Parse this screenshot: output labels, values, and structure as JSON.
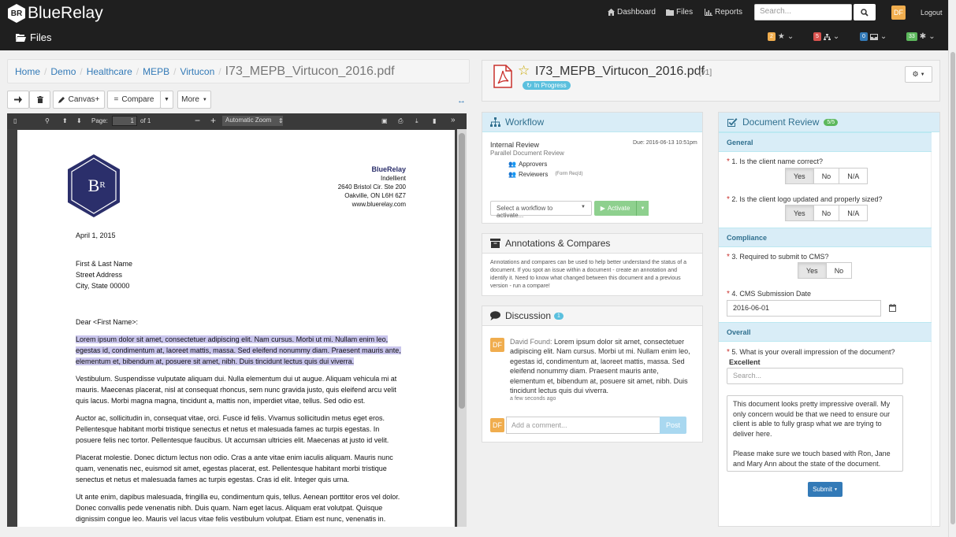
{
  "app": {
    "name": "BlueRelay",
    "logo_mark": "BR",
    "page_title": "Files"
  },
  "nav": {
    "dashboard": "Dashboard",
    "files": "Files",
    "reports": "Reports",
    "search_placeholder": "Search...",
    "avatar": "DF",
    "logout": "Logout"
  },
  "badges": [
    {
      "count": "2",
      "color": "#f0ad4e",
      "icon": "star-icon"
    },
    {
      "count": "5",
      "color": "#d9534f",
      "icon": "sitemap-icon"
    },
    {
      "count": "0",
      "color": "#337ab7",
      "icon": "inbox-icon"
    },
    {
      "count": "33",
      "color": "#5cb85c",
      "icon": "asterisk-icon"
    }
  ],
  "breadcrumb": {
    "items": [
      "Home",
      "Demo",
      "Healthcare",
      "MEPB",
      "Virtucon"
    ],
    "current": "I73_MEPB_Virtucon_2016.pdf"
  },
  "toolbar": {
    "canvas": "Canvas+",
    "compare": "Compare",
    "more": "More"
  },
  "viewer": {
    "page_label": "Page:",
    "page": "1",
    "of": "of 1",
    "zoom": "Automatic Zoom"
  },
  "pdf": {
    "company": "BlueRelay",
    "addr1": "Indellient",
    "addr2": "2640 Bristol Cir. Ste 200",
    "addr3": "Oakville, ON L6H 6Z7",
    "addr4": "www.bluerelay.com",
    "date": "April 1, 2015",
    "to1": "First & Last Name",
    "to2": "Street Address",
    "to3": "City, State 00000",
    "greeting": "Dear <First Name>:",
    "p1": "Lorem ipsum dolor sit amet, consectetuer adipiscing elit. Nam cursus. Morbi ut mi. Nullam enim leo, egestas id, condimentum at, laoreet mattis, massa. Sed eleifend nonummy diam. Praesent mauris ante, elementum et, bibendum at, posuere sit amet, nibh. Duis tincidunt lectus quis dui viverra.",
    "p2": "Vestibulum. Suspendisse vulputate aliquam dui. Nulla elementum dui ut augue. Aliquam vehicula mi at mauris. Maecenas placerat, nisl at consequat rhoncus, sem nunc gravida justo, quis eleifend arcu velit quis lacus. Morbi magna magna, tincidunt a, mattis non, imperdiet vitae, tellus. Sed odio est.",
    "p3": "Auctor ac, sollicitudin in, consequat vitae, orci. Fusce id felis. Vivamus sollicitudin metus eget eros. Pellentesque habitant morbi tristique senectus et netus et malesuada fames ac turpis egestas. In posuere felis nec tortor. Pellentesque faucibus. Ut accumsan ultricies elit. Maecenas at justo id velit.",
    "p4": "Placerat molestie. Donec dictum lectus non odio. Cras a ante vitae enim iaculis aliquam. Mauris nunc quam, venenatis nec, euismod sit amet, egestas placerat, est. Pellentesque habitant morbi tristique senectus et netus et malesuada fames ac turpis egestas. Cras id elit. Integer quis urna.",
    "p5": "Ut ante enim, dapibus malesuada, fringilla eu, condimentum quis, tellus. Aenean porttitor eros vel dolor. Donec convallis pede venenatis nibh. Duis quam. Nam eget lacus. Aliquam erat volutpat. Quisque dignissim congue leo. Mauris vel lacus vitae felis vestibulum volutpat. Etiam est nunc, venenatis in."
  },
  "document": {
    "title": "I73_MEPB_Virtucon_2016.pdf",
    "version": "[v1]",
    "status": "In Progress"
  },
  "workflow": {
    "title": "Workflow",
    "name": "Internal Review",
    "due": "Due: 2016-06-13 10:51pm",
    "type": "Parallel Document Review",
    "approvers": "Approvers",
    "reviewers": "Reviewers",
    "form_req": "(Form Req'd)",
    "select_placeholder": "Select a workflow to activate...",
    "activate": "Activate"
  },
  "annotations": {
    "title": "Annotations & Compares",
    "text": "Annotations and compares can be used to help better understand the status of a document. If you spot an issue within a document - create an annotation and identify it. Need to know what changed between this document and a previous version - run a compare!"
  },
  "discussion": {
    "title": "Discussion",
    "count": "1",
    "avatar": "DF",
    "author": "David Found:",
    "text": "Lorem ipsum dolor sit amet, consectetuer adipiscing elit. Nam cursus. Morbi ut mi. Nullam enim leo, egestas id, condimentum at, laoreet mattis, massa. Sed eleifend nonummy diam. Praesent mauris ante, elementum et, bibendum at, posuere sit amet, nibh. Duis tincidunt lectus quis dui viverra.",
    "time": "a few seconds ago",
    "comment_placeholder": "Add a comment...",
    "post": "Post"
  },
  "review": {
    "title": "Document Review",
    "count": "5/5",
    "general": "General",
    "q1": "1. Is the client name correct?",
    "q2": "2. Is the client logo updated and properly sized?",
    "compliance": "Compliance",
    "q3": "3. Required to submit to CMS?",
    "q4": "4. CMS Submission Date",
    "q4_value": "2016-06-01",
    "overall": "Overall",
    "q5": "5. What is your overall impression of the document?",
    "q5_value": "Excellent",
    "search_placeholder": "Search...",
    "comment": "This document looks pretty impressive overall. My only concern would be that we need to ensure our client is able to fully grasp what we are trying to deliver here.\n\nPlease make sure we touch based with Ron, Jane and Mary Ann about the state of the document.",
    "yes": "Yes",
    "no": "No",
    "na": "N/A",
    "submit": "Submit"
  }
}
